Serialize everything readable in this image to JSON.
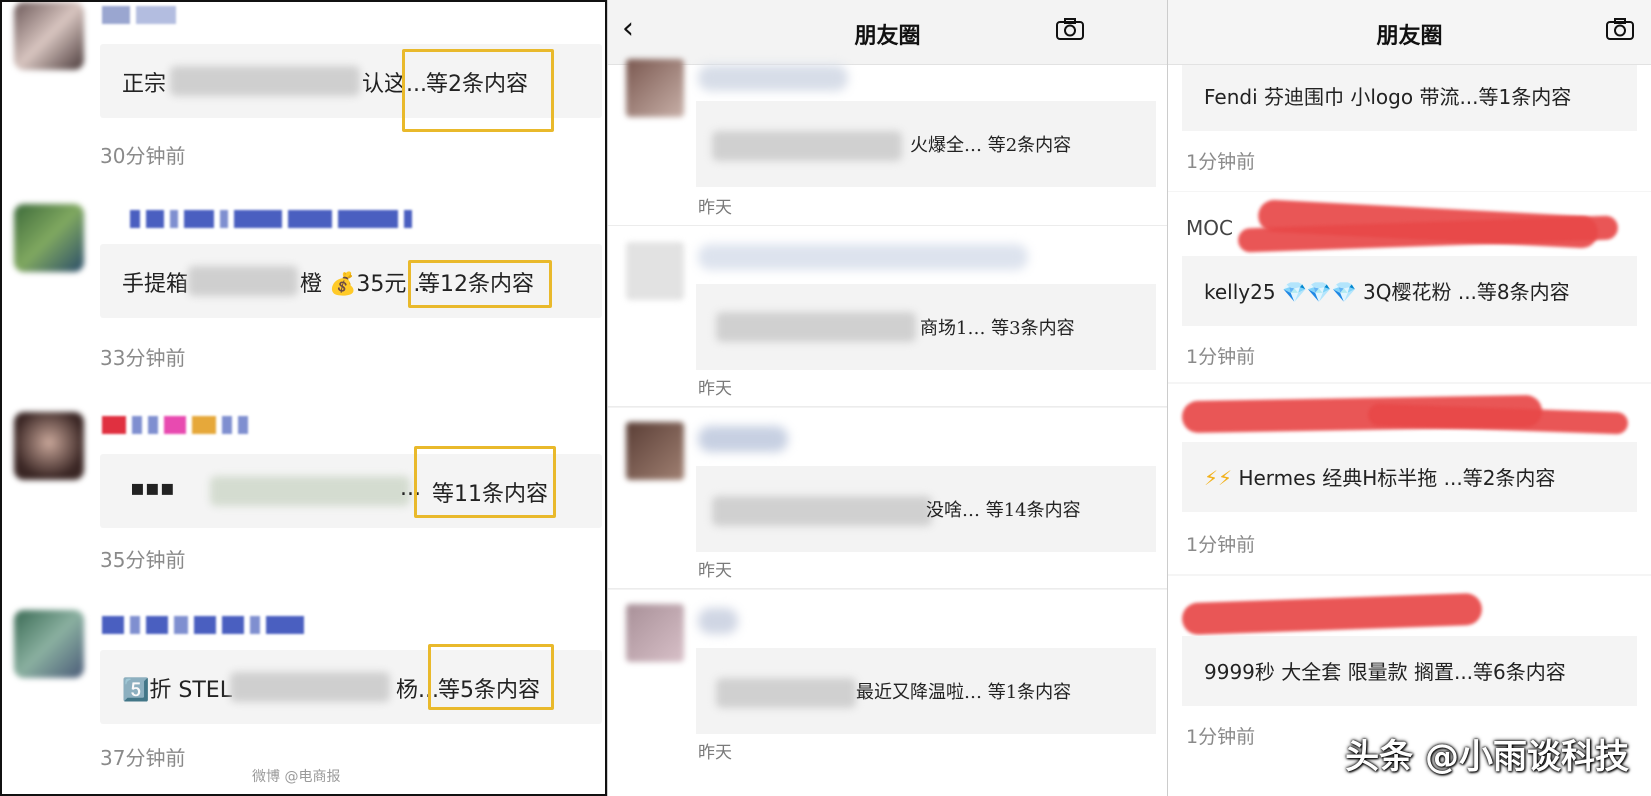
{
  "panel1": {
    "items": [
      {
        "text_start": "正宗",
        "text_end": "认这...",
        "count": "等2条内容",
        "time": "30分钟前"
      },
      {
        "text_start": "手提箱",
        "text_end": "橙 💰35元...",
        "count": "等12条内容",
        "time": "33分钟前"
      },
      {
        "text_start": "",
        "text_end": "...",
        "count": "等11条内容",
        "time": "35分钟前"
      },
      {
        "text_start": "5️⃣折 STEL",
        "text_end": "杨...",
        "count": "等5条内容",
        "time": "37分钟前"
      }
    ]
  },
  "panel2": {
    "title": "朋友圈",
    "items": [
      {
        "text": "火爆全… 等2条内容",
        "time": "昨天"
      },
      {
        "text": "商场1… 等3条内容",
        "time": "昨天"
      },
      {
        "text": "没啥… 等14条内容",
        "time": "昨天"
      },
      {
        "text": "最近又降温啦… 等1条内容",
        "time": "昨天"
      }
    ]
  },
  "panel3": {
    "title": "朋友圈",
    "items": [
      {
        "text": "Fendi 芬迪围巾 小logo 带流...等1条内容",
        "time": "1分钟前",
        "name": ""
      },
      {
        "text_pre": "kelly25 ",
        "icons": "💎💎💎",
        "text_post": " 3Q樱花粉 ...等8条内容",
        "time": "1分钟前",
        "name": "MOC"
      },
      {
        "icons": "⚡⚡",
        "text_post": "Hermes 经典H标半拖 ...等2条内容",
        "time": "1分钟前"
      },
      {
        "text": "9999秒 大全套 限量款 搁置...等6条内容",
        "time": "1分钟前"
      }
    ]
  },
  "watermark": "头条 @小雨谈科技",
  "weibo_mark": "微博 @电商报",
  "colors": {
    "highlight": "#e9b92b",
    "scribble": "#e84848"
  }
}
